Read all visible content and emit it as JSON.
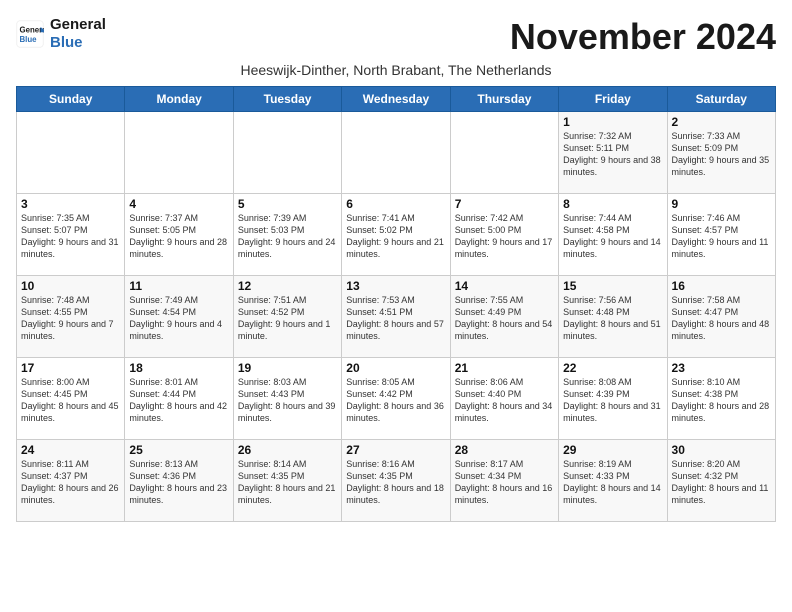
{
  "header": {
    "logo_line1": "General",
    "logo_line2": "Blue",
    "month_title": "November 2024",
    "subtitle": "Heeswijk-Dinther, North Brabant, The Netherlands"
  },
  "weekdays": [
    "Sunday",
    "Monday",
    "Tuesday",
    "Wednesday",
    "Thursday",
    "Friday",
    "Saturday"
  ],
  "weeks": [
    [
      {
        "day": "",
        "info": ""
      },
      {
        "day": "",
        "info": ""
      },
      {
        "day": "",
        "info": ""
      },
      {
        "day": "",
        "info": ""
      },
      {
        "day": "",
        "info": ""
      },
      {
        "day": "1",
        "info": "Sunrise: 7:32 AM\nSunset: 5:11 PM\nDaylight: 9 hours\nand 38 minutes."
      },
      {
        "day": "2",
        "info": "Sunrise: 7:33 AM\nSunset: 5:09 PM\nDaylight: 9 hours\nand 35 minutes."
      }
    ],
    [
      {
        "day": "3",
        "info": "Sunrise: 7:35 AM\nSunset: 5:07 PM\nDaylight: 9 hours\nand 31 minutes."
      },
      {
        "day": "4",
        "info": "Sunrise: 7:37 AM\nSunset: 5:05 PM\nDaylight: 9 hours\nand 28 minutes."
      },
      {
        "day": "5",
        "info": "Sunrise: 7:39 AM\nSunset: 5:03 PM\nDaylight: 9 hours\nand 24 minutes."
      },
      {
        "day": "6",
        "info": "Sunrise: 7:41 AM\nSunset: 5:02 PM\nDaylight: 9 hours\nand 21 minutes."
      },
      {
        "day": "7",
        "info": "Sunrise: 7:42 AM\nSunset: 5:00 PM\nDaylight: 9 hours\nand 17 minutes."
      },
      {
        "day": "8",
        "info": "Sunrise: 7:44 AM\nSunset: 4:58 PM\nDaylight: 9 hours\nand 14 minutes."
      },
      {
        "day": "9",
        "info": "Sunrise: 7:46 AM\nSunset: 4:57 PM\nDaylight: 9 hours\nand 11 minutes."
      }
    ],
    [
      {
        "day": "10",
        "info": "Sunrise: 7:48 AM\nSunset: 4:55 PM\nDaylight: 9 hours\nand 7 minutes."
      },
      {
        "day": "11",
        "info": "Sunrise: 7:49 AM\nSunset: 4:54 PM\nDaylight: 9 hours\nand 4 minutes."
      },
      {
        "day": "12",
        "info": "Sunrise: 7:51 AM\nSunset: 4:52 PM\nDaylight: 9 hours\nand 1 minute."
      },
      {
        "day": "13",
        "info": "Sunrise: 7:53 AM\nSunset: 4:51 PM\nDaylight: 8 hours\nand 57 minutes."
      },
      {
        "day": "14",
        "info": "Sunrise: 7:55 AM\nSunset: 4:49 PM\nDaylight: 8 hours\nand 54 minutes."
      },
      {
        "day": "15",
        "info": "Sunrise: 7:56 AM\nSunset: 4:48 PM\nDaylight: 8 hours\nand 51 minutes."
      },
      {
        "day": "16",
        "info": "Sunrise: 7:58 AM\nSunset: 4:47 PM\nDaylight: 8 hours\nand 48 minutes."
      }
    ],
    [
      {
        "day": "17",
        "info": "Sunrise: 8:00 AM\nSunset: 4:45 PM\nDaylight: 8 hours\nand 45 minutes."
      },
      {
        "day": "18",
        "info": "Sunrise: 8:01 AM\nSunset: 4:44 PM\nDaylight: 8 hours\nand 42 minutes."
      },
      {
        "day": "19",
        "info": "Sunrise: 8:03 AM\nSunset: 4:43 PM\nDaylight: 8 hours\nand 39 minutes."
      },
      {
        "day": "20",
        "info": "Sunrise: 8:05 AM\nSunset: 4:42 PM\nDaylight: 8 hours\nand 36 minutes."
      },
      {
        "day": "21",
        "info": "Sunrise: 8:06 AM\nSunset: 4:40 PM\nDaylight: 8 hours\nand 34 minutes."
      },
      {
        "day": "22",
        "info": "Sunrise: 8:08 AM\nSunset: 4:39 PM\nDaylight: 8 hours\nand 31 minutes."
      },
      {
        "day": "23",
        "info": "Sunrise: 8:10 AM\nSunset: 4:38 PM\nDaylight: 8 hours\nand 28 minutes."
      }
    ],
    [
      {
        "day": "24",
        "info": "Sunrise: 8:11 AM\nSunset: 4:37 PM\nDaylight: 8 hours\nand 26 minutes."
      },
      {
        "day": "25",
        "info": "Sunrise: 8:13 AM\nSunset: 4:36 PM\nDaylight: 8 hours\nand 23 minutes."
      },
      {
        "day": "26",
        "info": "Sunrise: 8:14 AM\nSunset: 4:35 PM\nDaylight: 8 hours\nand 21 minutes."
      },
      {
        "day": "27",
        "info": "Sunrise: 8:16 AM\nSunset: 4:35 PM\nDaylight: 8 hours\nand 18 minutes."
      },
      {
        "day": "28",
        "info": "Sunrise: 8:17 AM\nSunset: 4:34 PM\nDaylight: 8 hours\nand 16 minutes."
      },
      {
        "day": "29",
        "info": "Sunrise: 8:19 AM\nSunset: 4:33 PM\nDaylight: 8 hours\nand 14 minutes."
      },
      {
        "day": "30",
        "info": "Sunrise: 8:20 AM\nSunset: 4:32 PM\nDaylight: 8 hours\nand 11 minutes."
      }
    ]
  ]
}
